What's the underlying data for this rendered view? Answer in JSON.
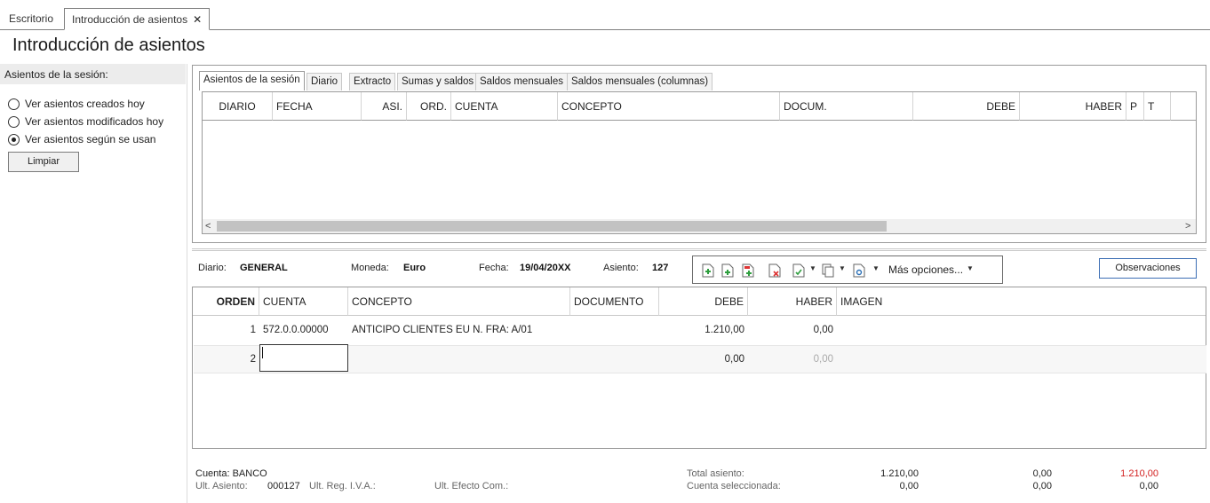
{
  "top_tabs": [
    {
      "label": "Escritorio"
    },
    {
      "label": "Introducción de asientos"
    }
  ],
  "page_title": "Introducción de asientos",
  "left": {
    "header": "Asientos de la sesión:",
    "options": [
      {
        "label": "Ver asientos creados hoy",
        "checked": false
      },
      {
        "label": "Ver asientos modificados hoy",
        "checked": false
      },
      {
        "label": "Ver asientos según se usan",
        "checked": true
      }
    ],
    "clear_button": "Limpiar"
  },
  "upper": {
    "tabs": [
      "Asientos de la sesión",
      "Diario",
      "Extracto",
      "Sumas y saldos",
      "Saldos mensuales",
      "Saldos mensuales (columnas)"
    ],
    "columns": [
      "DIARIO",
      "FECHA",
      "ASI.",
      "ORD.",
      "CUENTA",
      "CONCEPTO",
      "DOCUM.",
      "DEBE",
      "HABER",
      "P",
      "T"
    ]
  },
  "info": {
    "diario_label": "Diario:",
    "diario_value": "GENERAL",
    "moneda_label": "Moneda:",
    "moneda_value": "Euro",
    "fecha_label": "Fecha:",
    "fecha_value": "19/04/20XX",
    "asiento_label": "Asiento:",
    "asiento_value": "127",
    "more_options": "Más opciones...",
    "observaciones": "Observaciones"
  },
  "lower": {
    "columns": [
      "ORDEN",
      "CUENTA",
      "CONCEPTO",
      "DOCUMENTO",
      "DEBE",
      "HABER",
      "IMAGEN"
    ],
    "rows": [
      {
        "orden": "1",
        "cuenta": "572.0.0.00000",
        "concepto": "ANTICIPO CLIENTES EU N. FRA:  A/01",
        "documento": "",
        "debe": "1.210,00",
        "haber": "0,00"
      },
      {
        "orden": "2",
        "cuenta": "",
        "concepto": "",
        "documento": "",
        "debe": "0,00",
        "haber": "0,00"
      }
    ]
  },
  "footer": {
    "cuenta": "Cuenta: BANCO",
    "ult_asiento_label": "Ult. Asiento:",
    "ult_asiento_value": "000127",
    "ult_reg_iva_label": "Ult. Reg. I.V.A.:",
    "ult_efecto_label": "Ult. Efecto Com.:",
    "total_asiento_label": "Total asiento:",
    "cuenta_sel_label": "Cuenta seleccionada:",
    "total_debe": "1.210,00",
    "total_haber": "0,00",
    "total_saldo": "1.210,00",
    "sel_debe": "0,00",
    "sel_haber": "0,00",
    "sel_saldo": "0,00",
    "saldo_color": "#d21f1f"
  }
}
